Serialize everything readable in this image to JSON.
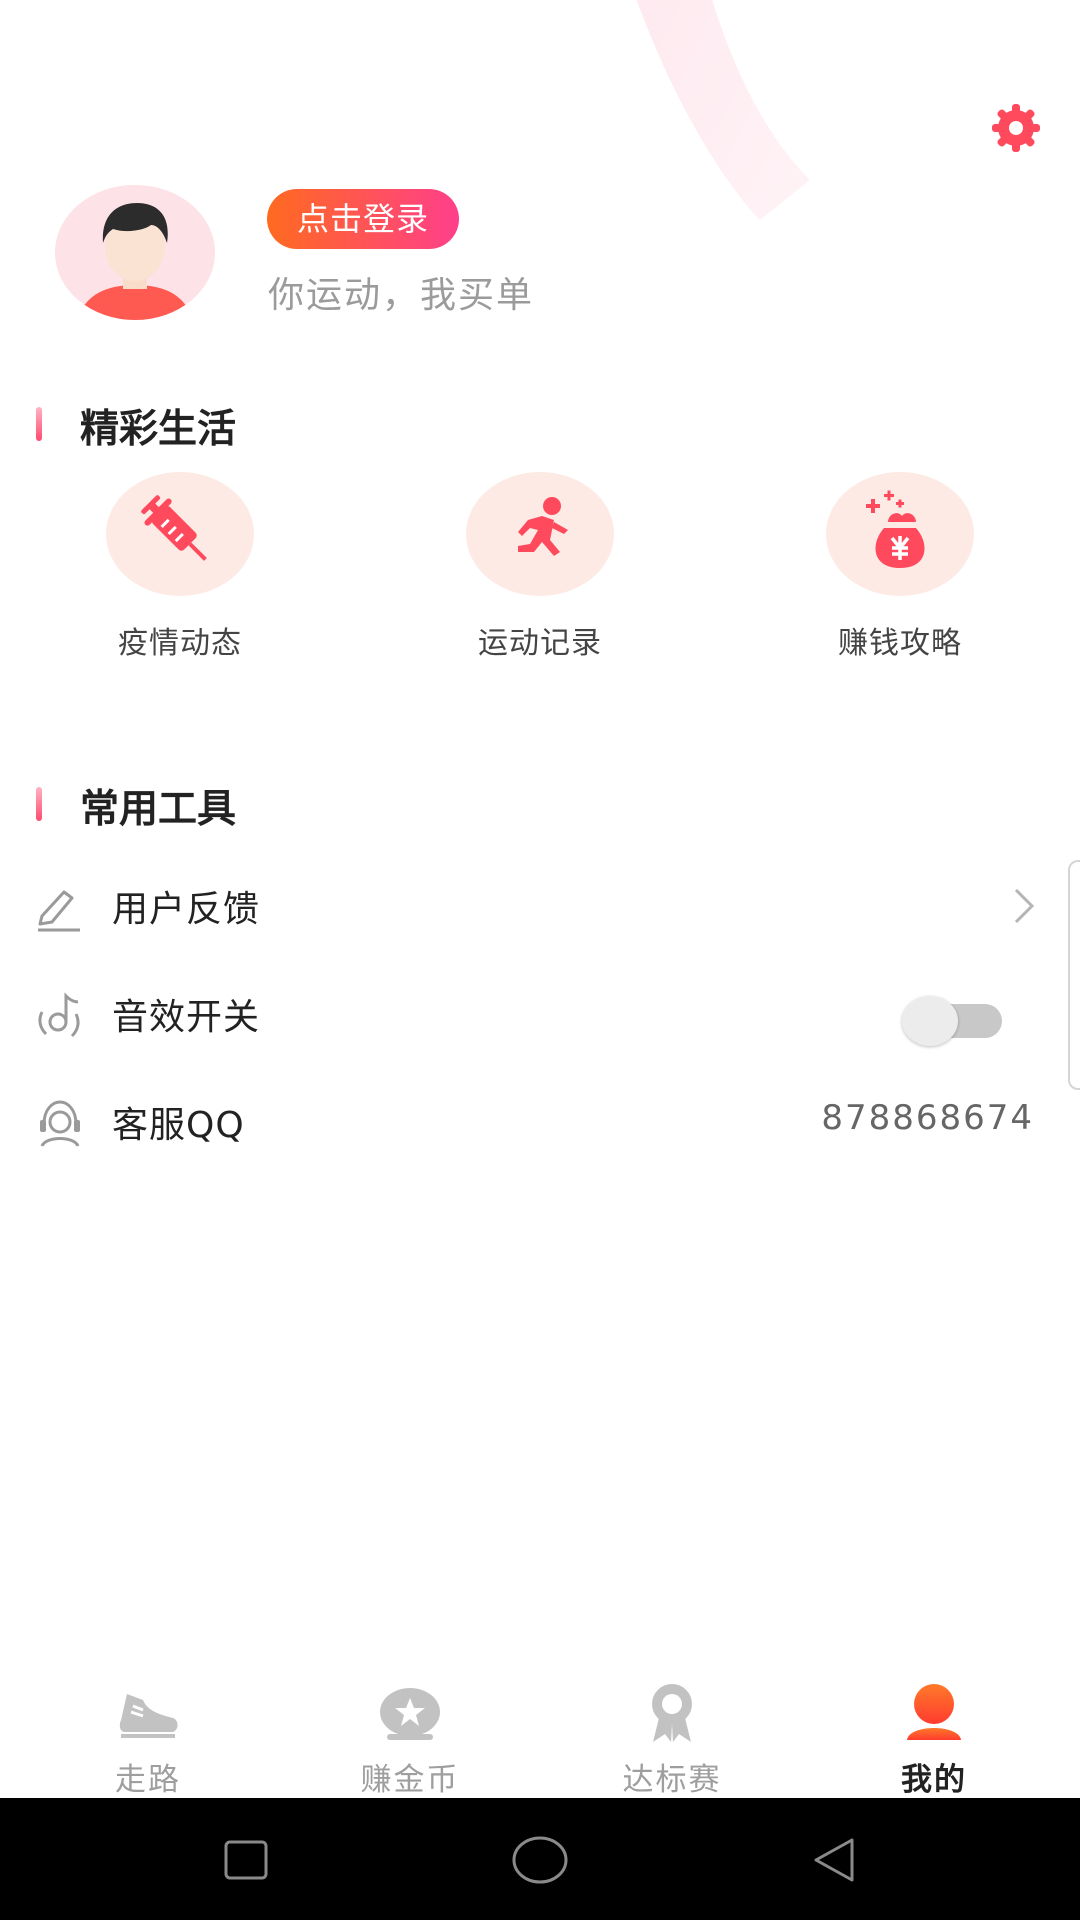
{
  "profile": {
    "login_label": "点击登录",
    "slogan": "你运动，我买单"
  },
  "sections": {
    "life_title": "精彩生活",
    "tools_title": "常用工具"
  },
  "features": [
    {
      "label": "疫情动态",
      "icon": "syringe-icon"
    },
    {
      "label": "运动记录",
      "icon": "running-man-icon"
    },
    {
      "label": "赚钱攻略",
      "icon": "money-bag-icon"
    }
  ],
  "tools": {
    "feedback_label": "用户反馈",
    "sound_label": "音效开关",
    "sound_on": false,
    "qq_label": "客服QQ",
    "qq_value": "878868674"
  },
  "tabs": [
    {
      "label": "走路",
      "icon": "shoe-icon"
    },
    {
      "label": "赚金币",
      "icon": "coin-star-icon"
    },
    {
      "label": "达标赛",
      "icon": "medal-icon"
    },
    {
      "label": "我的",
      "icon": "user-icon",
      "active": true
    }
  ],
  "colors": {
    "accent_start": "#ff6a1f",
    "accent_end": "#ff3f8b",
    "icon_red": "#ff4a5e"
  }
}
